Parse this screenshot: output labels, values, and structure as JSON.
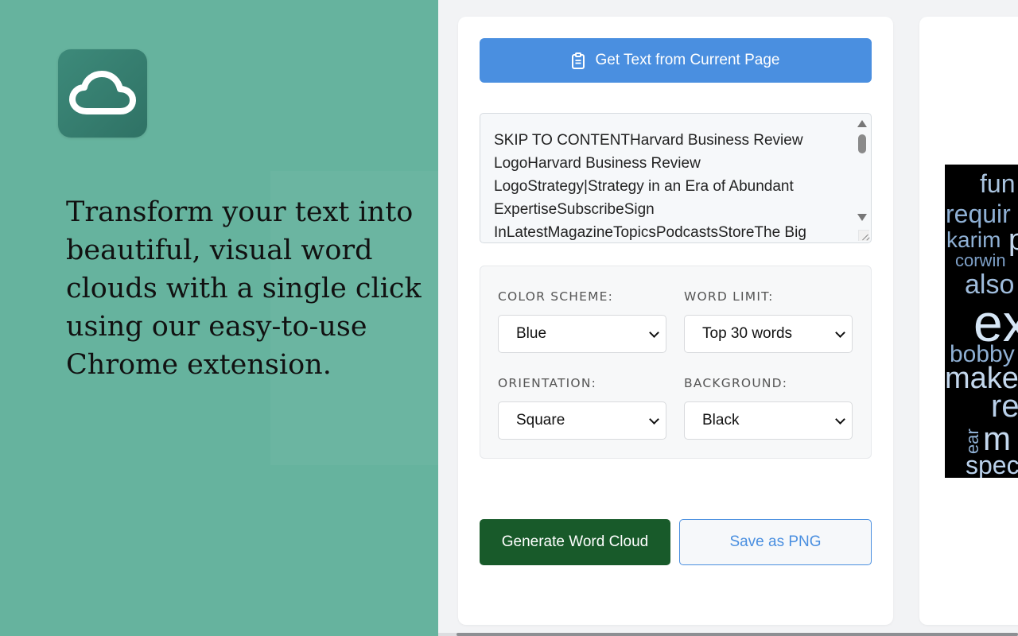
{
  "promo": {
    "tagline": "Transform your text into beautiful, visual word clouds with a single click using our easy-to-use Chrome extension.",
    "logo_icon": "cloud-icon"
  },
  "extension": {
    "get_text_label": "Get Text from Current Page",
    "get_text_icon": "clipboard-icon",
    "text_content": "SKIP TO CONTENTHarvard Business Review\nLogoHarvard Business Review\nLogoStrategy|Strategy in an Era of Abundant\nExpertiseSubscribeSign\nInLatestMagazineTopicsPodcastsStoreThe Big",
    "options": {
      "color_scheme_label": "COLOR SCHEME:",
      "color_scheme_value": "Blue",
      "word_limit_label": "WORD LIMIT:",
      "word_limit_value": "Top 30 words",
      "orientation_label": "ORIENTATION:",
      "orientation_value": "Square",
      "background_label": "BACKGROUND:",
      "background_value": "Black"
    },
    "generate_label": "Generate Word Cloud",
    "save_label": "Save as PNG"
  },
  "word_cloud": {
    "background": "#000000",
    "words": [
      {
        "text": "fun",
        "color": "#aac4df"
      },
      {
        "text": "requir",
        "color": "#8fb0d4"
      },
      {
        "text": "karim",
        "color": "#8fb0d4"
      },
      {
        "text": "p",
        "color": "#c4d8ee"
      },
      {
        "text": "corwin",
        "color": "#7d9fc6"
      },
      {
        "text": "also",
        "color": "#9fbcdc"
      },
      {
        "text": "ex",
        "color": "#d6e6f6"
      },
      {
        "text": "bobby",
        "color": "#8fb0d4"
      },
      {
        "text": "make",
        "color": "#c4d8ee"
      },
      {
        "text": "re",
        "color": "#b9d0ea"
      },
      {
        "text": "m",
        "color": "#c4d8ee"
      },
      {
        "text": "ear",
        "color": "#8fb0d4"
      },
      {
        "text": "spec",
        "color": "#b9d0ea"
      }
    ]
  },
  "colors": {
    "left_bg": "#66b39e",
    "primary_blue": "#4a8fe0",
    "generate_green": "#185a2a"
  }
}
